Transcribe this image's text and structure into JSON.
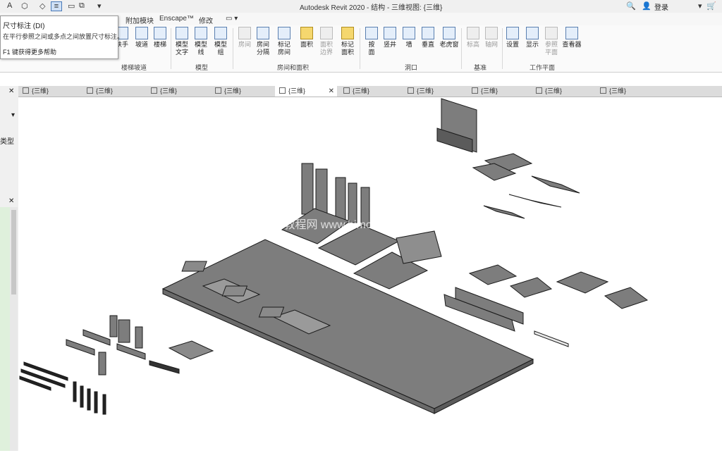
{
  "app": {
    "title": "Autodesk Revit 2020 - 结构 - 三维视图: {三维}",
    "login_label": "登录"
  },
  "ribbon_tabs": [
    {
      "label": "附加模块"
    },
    {
      "label": "Enscape™"
    },
    {
      "label": "修改"
    }
  ],
  "tooltip": {
    "title": "尺寸标注 (DI)",
    "description": "在平行参照之间或多点之间放置尺寸标注。",
    "help": "F1 键获得更多帮助"
  },
  "ribbon": {
    "buttons": [
      {
        "label": "扶手"
      },
      {
        "label": "坡道"
      },
      {
        "label": "楼梯"
      },
      {
        "label": "模型\n文字"
      },
      {
        "label": "模型\n线"
      },
      {
        "label": "模型\n组"
      },
      {
        "label": "房间"
      },
      {
        "label": "房间\n分隔"
      },
      {
        "label": "标记\n房间"
      },
      {
        "label": "面积"
      },
      {
        "label": "面积\n边界"
      },
      {
        "label": "标记\n面积"
      },
      {
        "label": "按\n面"
      },
      {
        "label": "竖井"
      },
      {
        "label": "墙"
      },
      {
        "label": "垂直"
      },
      {
        "label": "老虎窗"
      },
      {
        "label": "标高"
      },
      {
        "label": "轴网"
      },
      {
        "label": "设置"
      },
      {
        "label": "显示"
      },
      {
        "label": "参照\n平面"
      },
      {
        "label": "查看器"
      }
    ],
    "panels": [
      {
        "label": "楼梯坡道"
      },
      {
        "label": "模型"
      },
      {
        "label": "房间和面积"
      },
      {
        "label": "洞口"
      },
      {
        "label": "基准"
      },
      {
        "label": "工作平面"
      }
    ]
  },
  "view_tabs": [
    {
      "label": "{三维}"
    },
    {
      "label": "{三维}"
    },
    {
      "label": "{三维}"
    },
    {
      "label": "{三维}"
    },
    {
      "label": "{三维}"
    },
    {
      "label": "{三维}"
    },
    {
      "label": "{三维}"
    },
    {
      "label": "{三维}"
    },
    {
      "label": "{三维}"
    },
    {
      "label": "{三维}"
    }
  ],
  "left_panel": {
    "type_label": "类型"
  },
  "watermark": "BIM教程网 www.bimcn.com"
}
